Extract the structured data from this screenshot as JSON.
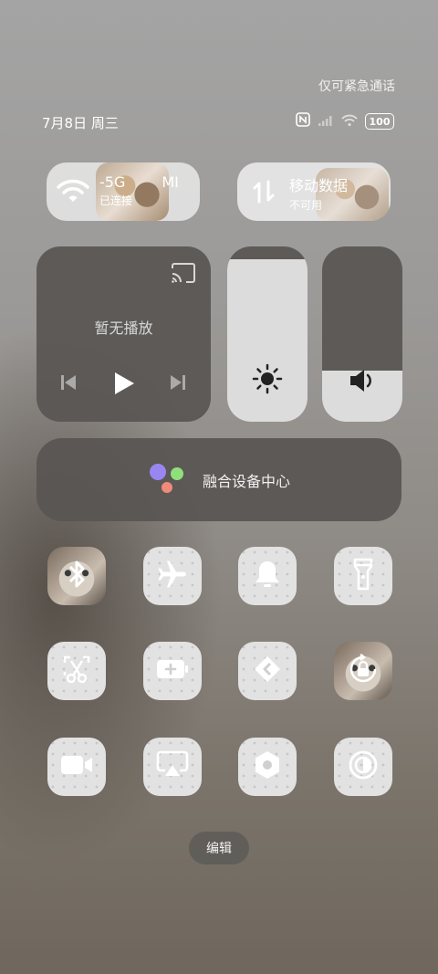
{
  "status_bar": {
    "emergency_text": "仅可紧急通话",
    "date_text": "7月8日 周三",
    "battery_level": "100"
  },
  "wifi_tile": {
    "ssid_text": "-5G",
    "ssid_extra": "MI",
    "status": "已连接"
  },
  "mobile_data_tile": {
    "title": "移动数据",
    "status": "不可用"
  },
  "media": {
    "status_text": "暂无播放"
  },
  "sliders": {
    "brightness_level": 1.0,
    "volume_level": 0.29
  },
  "fusion_center": {
    "label": "融合设备中心"
  },
  "toggles": [
    {
      "icon": "bluetooth-icon",
      "active": true
    },
    {
      "icon": "airplane-icon",
      "active": false
    },
    {
      "icon": "bell-icon",
      "active": false
    },
    {
      "icon": "flashlight-icon",
      "active": false
    },
    {
      "icon": "screenshot-scissors-icon",
      "active": false
    },
    {
      "icon": "battery-saver-icon",
      "active": false
    },
    {
      "icon": "nearby-share-icon",
      "active": false
    },
    {
      "icon": "rotation-lock-icon",
      "active": true
    },
    {
      "icon": "video-camera-icon",
      "active": false
    },
    {
      "icon": "screen-cast-icon",
      "active": false
    },
    {
      "icon": "settings-hex-icon",
      "active": false
    },
    {
      "icon": "contrast-icon",
      "active": false
    }
  ],
  "edit_button": {
    "label": "编辑"
  }
}
